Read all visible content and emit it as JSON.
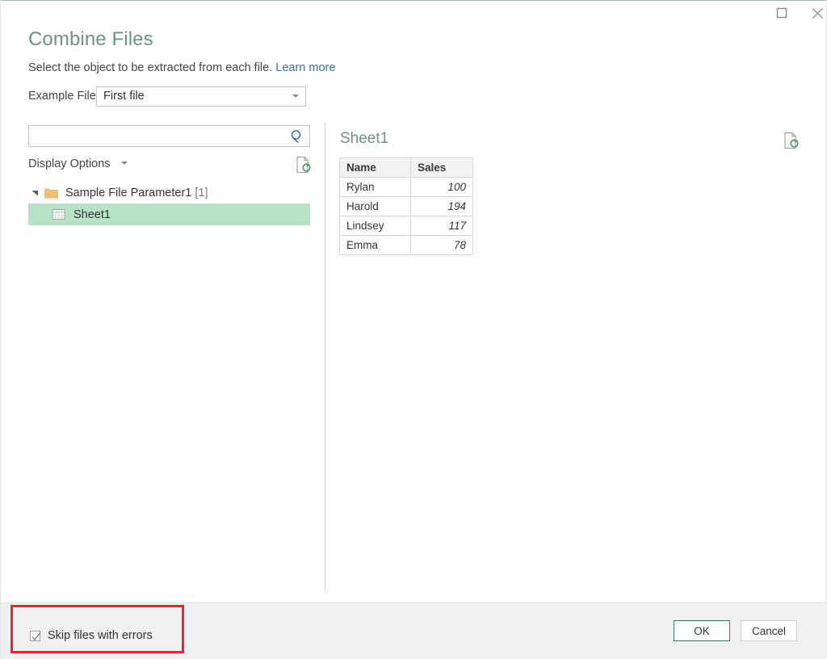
{
  "window": {
    "controls": [
      {
        "name": "maximize-button",
        "icon": "maximize-icon",
        "label": "Maximize"
      },
      {
        "name": "close-button",
        "icon": "close-icon",
        "label": "Close"
      }
    ]
  },
  "header": {
    "title": "Combine Files",
    "subtitle_text": "Select the object to be extracted from each file.",
    "learn_more": "Learn more"
  },
  "example_file": {
    "label": "Example File:",
    "selected": "First file",
    "options": [
      "First file"
    ]
  },
  "search": {
    "value": "",
    "placeholder": "",
    "icon": "search-icon"
  },
  "display_options": {
    "label": "Display Options",
    "refresh_icon": "refresh-preview-icon"
  },
  "tree": {
    "root": {
      "label": "Sample File Parameter1",
      "count": "[1]",
      "icon": "folder-icon",
      "expanded": true
    },
    "children": [
      {
        "label": "Sheet1",
        "icon": "sheet-table-icon",
        "selected": true
      }
    ]
  },
  "preview": {
    "title": "Sheet1",
    "refresh_icon": "refresh-preview-icon",
    "table": {
      "columns": [
        "Name",
        "Sales"
      ],
      "rows": [
        [
          "Rylan",
          "100"
        ],
        [
          "Harold",
          "194"
        ],
        [
          "Lindsey",
          "117"
        ],
        [
          "Emma",
          "78"
        ]
      ]
    }
  },
  "footer": {
    "skip_files_label": "Skip files with errors",
    "skip_files_checked": true,
    "ok_label": "OK",
    "cancel_label": "Cancel"
  },
  "annotation": {
    "color": "#ee2233"
  },
  "colors": {
    "accent_green": "#6d9384",
    "selection_green": "#b6e3c6",
    "link_blue": "#3f6f9f",
    "ok_border": "#2e7d5b",
    "footer_bg": "#f0f0f0"
  }
}
